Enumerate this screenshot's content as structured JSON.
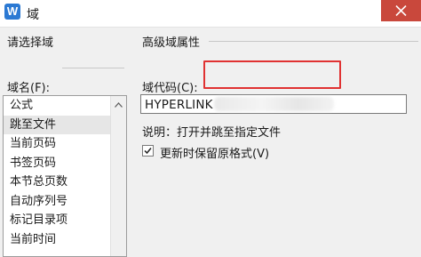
{
  "window": {
    "title": "域",
    "app_icon_letter": "W",
    "close_icon": "close-icon"
  },
  "left_panel": {
    "section_title": "请选择域",
    "field_name_label": "域名(F):",
    "field_list": {
      "items": [
        {
          "label": "公式",
          "selected": false
        },
        {
          "label": "跳至文件",
          "selected": true
        },
        {
          "label": "当前页码",
          "selected": false
        },
        {
          "label": "书签页码",
          "selected": false
        },
        {
          "label": "本节总页数",
          "selected": false
        },
        {
          "label": "自动序列号",
          "selected": false
        },
        {
          "label": "标记目录项",
          "selected": false
        },
        {
          "label": "当前时间",
          "selected": false
        }
      ]
    }
  },
  "right_panel": {
    "section_title": "高级域属性",
    "field_code_label": "域代码(C):",
    "field_code_value": "HYPERLINK",
    "description": "说明：打开并跳至指定文件",
    "update_checkbox": {
      "label": "更新时保留原格式(V)",
      "checked": true
    }
  },
  "colors": {
    "app_icon": "#2b79d3",
    "close_button": "#c9483c",
    "highlight_box": "#e03232",
    "selected_item": "#e6e6e6"
  }
}
